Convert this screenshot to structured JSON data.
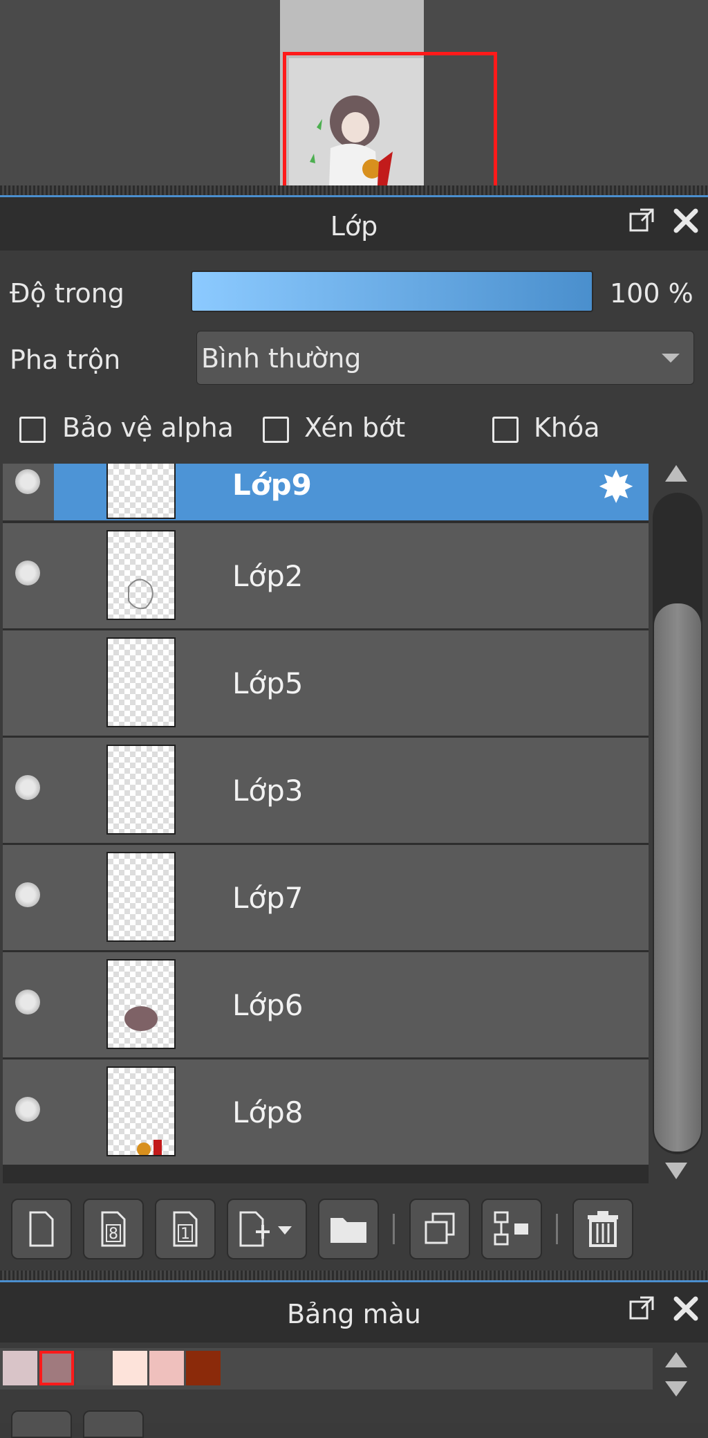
{
  "layers_panel": {
    "title": "Lớp",
    "opacity": {
      "label": "Độ trong",
      "value_text": "100 %",
      "value": 1.0
    },
    "blend": {
      "label": "Pha trộn",
      "value": "Bình thường"
    },
    "options": [
      {
        "label": "Bảo vệ alpha",
        "checked": false
      },
      {
        "label": "Xén bớt",
        "checked": false
      },
      {
        "label": "Khóa",
        "checked": false
      }
    ],
    "layers": [
      {
        "name": "Lớp9",
        "visible": true,
        "selected": true
      },
      {
        "name": "Lớp2",
        "visible": true,
        "selected": false
      },
      {
        "name": "Lớp5",
        "visible": false,
        "selected": false
      },
      {
        "name": "Lớp3",
        "visible": true,
        "selected": false
      },
      {
        "name": "Lớp7",
        "visible": true,
        "selected": false
      },
      {
        "name": "Lớp6",
        "visible": true,
        "selected": false
      },
      {
        "name": "Lớp8",
        "visible": true,
        "selected": false
      }
    ],
    "toolbar_icons": [
      "new-layer-icon",
      "new-8bit-layer-icon",
      "new-1bit-layer-icon",
      "add-layer-dropdown-icon",
      "new-folder-icon",
      "duplicate-layer-icon",
      "merge-down-icon",
      "trash-icon"
    ]
  },
  "palette_panel": {
    "title": "Bảng màu",
    "swatches": [
      "#d9c4c8",
      "#a07a7e",
      "#4d4d4d",
      "#fde3da",
      "#efc0bd",
      "#8b2a0a"
    ],
    "selected_index": 1
  },
  "colors": {
    "accent_blue": "#4d94d6",
    "selection_red": "#ff1a1a"
  }
}
